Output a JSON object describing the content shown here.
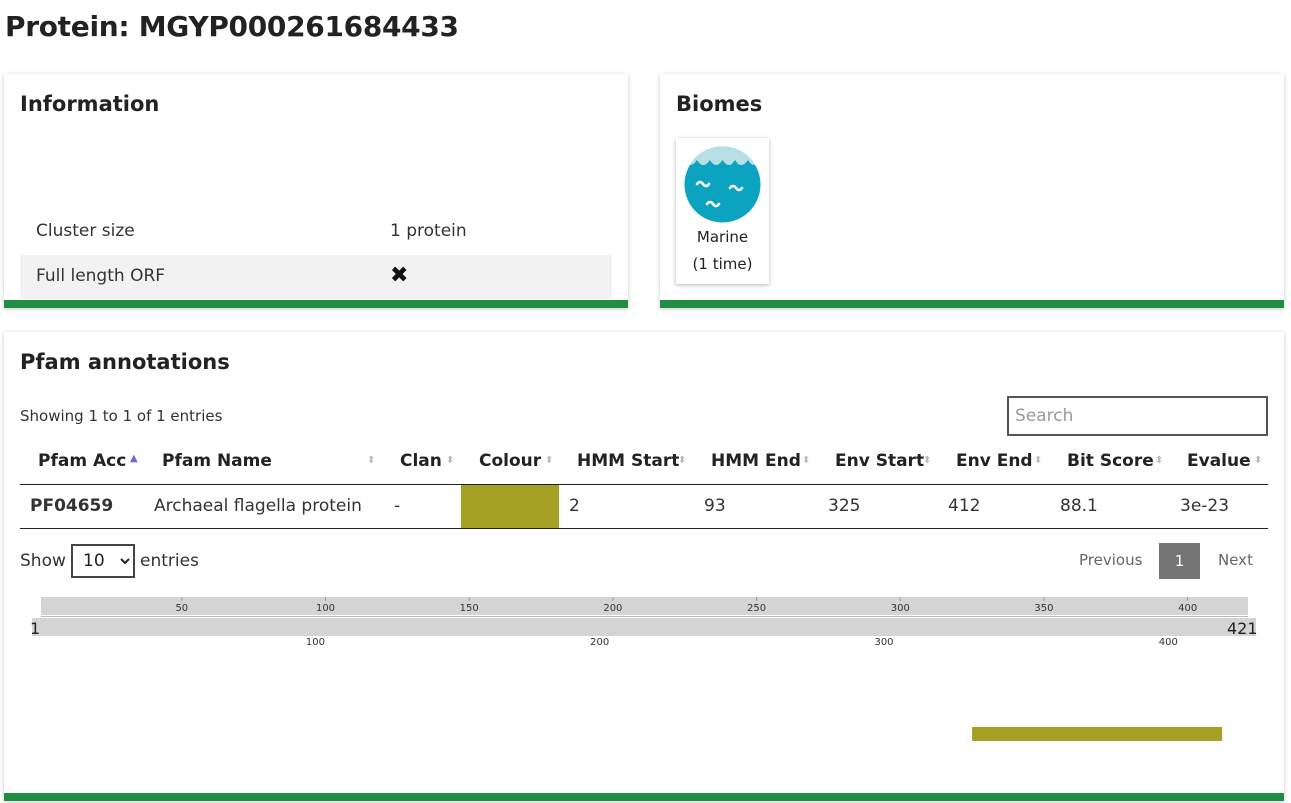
{
  "page": {
    "title": "Protein: MGYP000261684433"
  },
  "information": {
    "title": "Information",
    "rows": [
      {
        "label": "Cluster size",
        "value": "1 protein"
      },
      {
        "label": "Full length ORF",
        "value": "✖"
      }
    ]
  },
  "biomes": {
    "title": "Biomes",
    "items": [
      {
        "name": "Marine",
        "count": "(1 time)",
        "icon": "marine-waves-icon"
      }
    ]
  },
  "pfam": {
    "title": "Pfam annotations",
    "info": "Showing 1 to 1 of 1 entries",
    "search_placeholder": "Search",
    "columns": [
      "Pfam Acc",
      "Pfam Name",
      "Clan",
      "Colour",
      "HMM Start",
      "HMM End",
      "Env Start",
      "Env End",
      "Bit Score",
      "Evalue"
    ],
    "rows": [
      {
        "acc": "PF04659",
        "name": "Archaeal flagella protein",
        "clan": "-",
        "colour": "#a3a024",
        "hmm_start": "2",
        "hmm_end": "93",
        "env_start": "325",
        "env_end": "412",
        "bit_score": "88.1",
        "evalue": "3e-23"
      }
    ],
    "length": {
      "show": "Show",
      "value": "10",
      "entries": "entries"
    },
    "pagination": {
      "previous": "Previous",
      "current": "1",
      "next": "Next"
    },
    "viewer": {
      "start": 1,
      "end": 421,
      "start_label": "1",
      "end_label": "421",
      "top_ticks": [
        "50",
        "100",
        "150",
        "200",
        "250",
        "300",
        "350",
        "400"
      ],
      "bottom_ticks": [
        "100",
        "200",
        "300",
        "400"
      ],
      "features": [
        {
          "start": 325,
          "end": 412,
          "color": "#a3a024"
        }
      ]
    }
  },
  "colors": {
    "accent_bar": "#1e8f45",
    "link": "#3f6fb5",
    "biome": "#0ba3c0",
    "sort_active": "#6c6ccc"
  }
}
